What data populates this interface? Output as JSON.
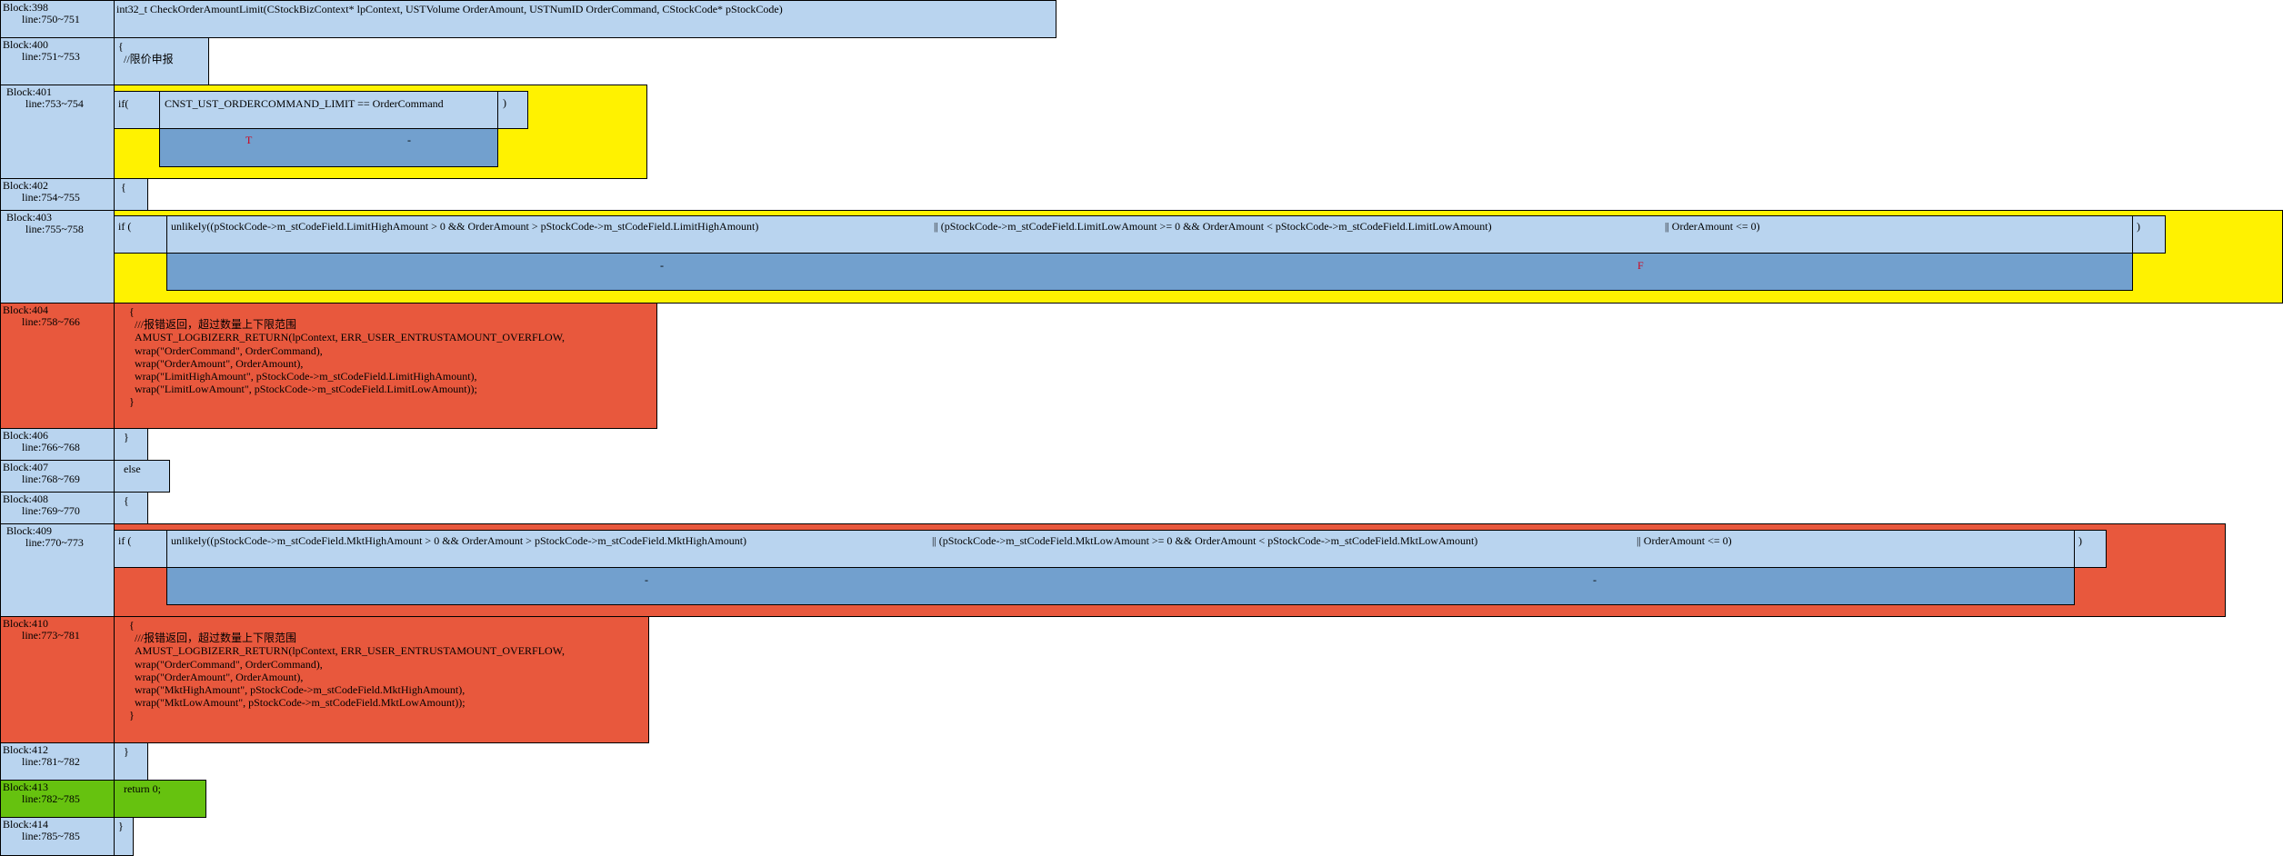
{
  "blocks": {
    "b398": {
      "id": "Block:398",
      "lines": "line:750~751",
      "code": "int32_t CheckOrderAmountLimit(CStockBizContext* lpContext, USTVolume OrderAmount, USTNumID OrderCommand, CStockCode* pStockCode)"
    },
    "b400": {
      "id": "Block:400",
      "lines": "line:751~753",
      "code": "{\n  //限价申报"
    },
    "b401": {
      "id": "Block:401",
      "lines": "line:753~754",
      "if": "if(",
      "cond": "CNST_UST_ORDERCOMMAND_LIMIT == OrderCommand",
      "close": ")",
      "t": "T",
      "f": "-"
    },
    "b402": {
      "id": "Block:402",
      "lines": "line:754~755",
      "code": "{"
    },
    "b403": {
      "id": "Block:403",
      "lines": "line:755~758",
      "if": "if (",
      "c1": "unlikely((pStockCode->m_stCodeField.LimitHighAmount > 0 && OrderAmount > pStockCode->m_stCodeField.LimitHighAmount)",
      "c2": "|| (pStockCode->m_stCodeField.LimitLowAmount >= 0 && OrderAmount < pStockCode->m_stCodeField.LimitLowAmount)",
      "c3": "|| OrderAmount <= 0)",
      "close": ")",
      "d1": "-",
      "d2": "F"
    },
    "b404": {
      "id": "Block:404",
      "lines": "line:758~766",
      "code": "    {\n      ///报错返回，超过数量上下限范围\n      AMUST_LOGBIZERR_RETURN(lpContext, ERR_USER_ENTRUSTAMOUNT_OVERFLOW,\n      wrap(\"OrderCommand\", OrderCommand),\n      wrap(\"OrderAmount\", OrderAmount),\n      wrap(\"LimitHighAmount\", pStockCode->m_stCodeField.LimitHighAmount),\n      wrap(\"LimitLowAmount\", pStockCode->m_stCodeField.LimitLowAmount));\n    }"
    },
    "b406": {
      "id": "Block:406",
      "lines": "line:766~768",
      "code": "  }"
    },
    "b407": {
      "id": "Block:407",
      "lines": "line:768~769",
      "code": "  else"
    },
    "b408": {
      "id": "Block:408",
      "lines": "line:769~770",
      "code": "  {"
    },
    "b409": {
      "id": "Block:409",
      "lines": "line:770~773",
      "if": "if (",
      "c1": "unlikely((pStockCode->m_stCodeField.MktHighAmount > 0 && OrderAmount > pStockCode->m_stCodeField.MktHighAmount)",
      "c2": "|| (pStockCode->m_stCodeField.MktLowAmount >= 0 && OrderAmount < pStockCode->m_stCodeField.MktLowAmount)",
      "c3": "|| OrderAmount <= 0)",
      "close": ")",
      "d1": "-",
      "d2": "-"
    },
    "b410": {
      "id": "Block:410",
      "lines": "line:773~781",
      "code": "    {\n      ///报错返回，超过数量上下限范围\n      AMUST_LOGBIZERR_RETURN(lpContext, ERR_USER_ENTRUSTAMOUNT_OVERFLOW,\n      wrap(\"OrderCommand\", OrderCommand),\n      wrap(\"OrderAmount\", OrderAmount),\n      wrap(\"MktHighAmount\", pStockCode->m_stCodeField.MktHighAmount),\n      wrap(\"MktLowAmount\", pStockCode->m_stCodeField.MktLowAmount));\n    }"
    },
    "b412": {
      "id": "Block:412",
      "lines": "line:781~782",
      "code": "  }"
    },
    "b413": {
      "id": "Block:413",
      "lines": "line:782~785",
      "code": "  return 0;"
    },
    "b414": {
      "id": "Block:414",
      "lines": "line:785~785",
      "code": "}"
    }
  },
  "colors": {
    "plain": "#b9d4ef",
    "error": "#e8583d",
    "return": "#66c20f",
    "branch": "#fff200",
    "condition": "#72a0ce",
    "branch_label": "#d0021b"
  }
}
